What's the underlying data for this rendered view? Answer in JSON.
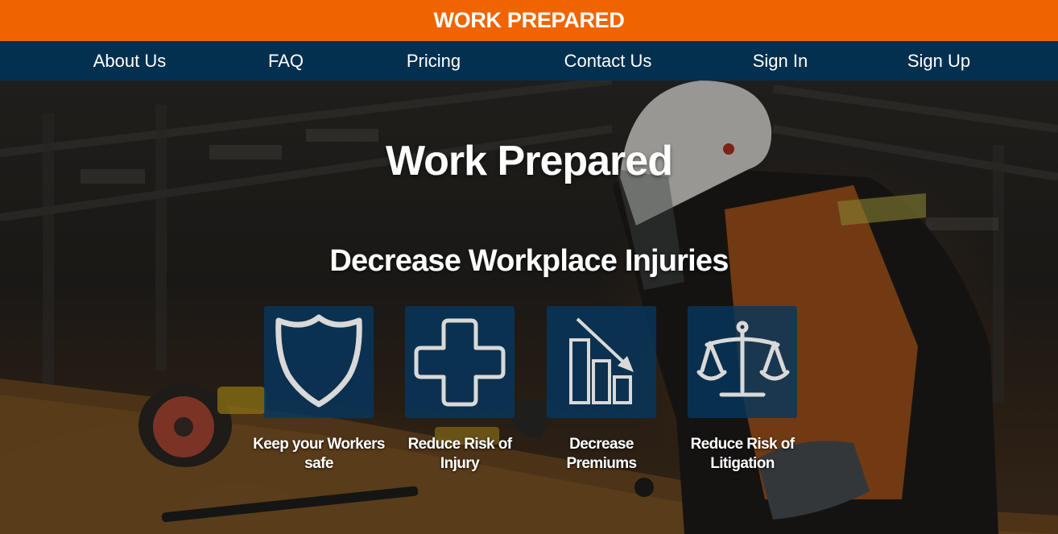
{
  "brand": {
    "title": "WORK PREPARED"
  },
  "nav": {
    "items": [
      {
        "label": "About Us"
      },
      {
        "label": "FAQ"
      },
      {
        "label": "Pricing"
      },
      {
        "label": "Contact Us"
      },
      {
        "label": "Sign In"
      },
      {
        "label": "Sign Up"
      }
    ]
  },
  "hero": {
    "title": "Work Prepared",
    "subtitle": "Decrease Workplace Injuries",
    "features": [
      {
        "icon": "shield-icon",
        "label": "Keep your Workers safe"
      },
      {
        "icon": "medical-cross-icon",
        "label": "Reduce Risk of Injury"
      },
      {
        "icon": "declining-bar-chart-icon",
        "label": "Decrease Premiums"
      },
      {
        "icon": "scales-of-justice-icon",
        "label": "Reduce Risk of Litigation"
      }
    ]
  },
  "colors": {
    "brand_bar": "#f06400",
    "nav_bar": "#04304f",
    "card": "#06375f",
    "text": "#ffffff"
  }
}
